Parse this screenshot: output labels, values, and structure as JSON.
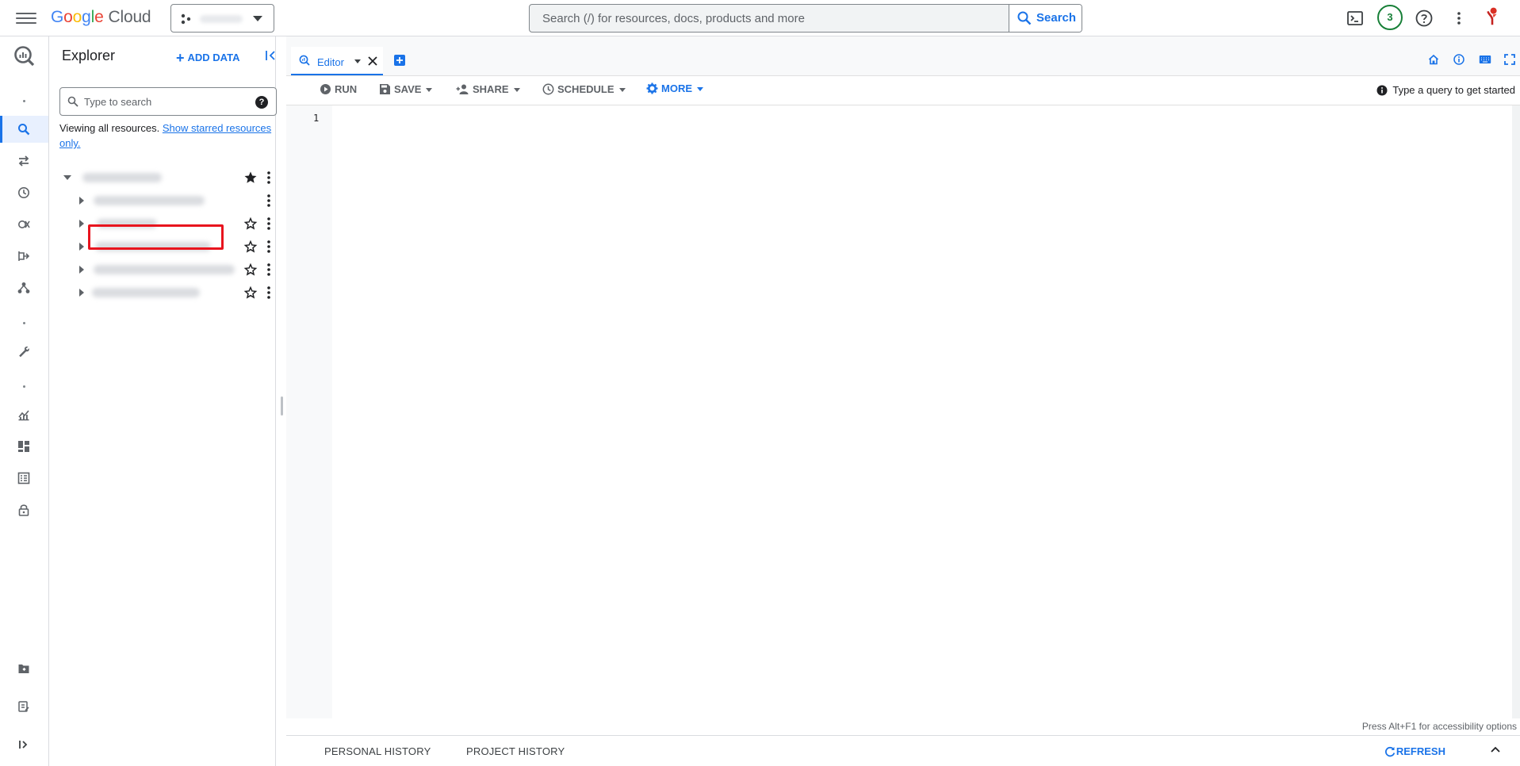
{
  "topbar": {
    "logo": {
      "letters": [
        "G",
        "o",
        "o",
        "g",
        "l",
        "e"
      ],
      "product": "Cloud"
    },
    "search": {
      "placeholder": "Search (/) for resources, docs, products and more",
      "button_label": "Search"
    },
    "notification_count": "3",
    "icons": [
      "menu-icon",
      "project-picker-icon",
      "cloud-shell-icon",
      "help-icon",
      "more-vert-icon",
      "account-avatar-icon"
    ]
  },
  "rail": {
    "icons": [
      "bigquery-logo-icon",
      "search-icon",
      "transfers-icon",
      "scheduled-queries-icon",
      "analytics-hub-icon",
      "dataflow-icon",
      "workflow-icon",
      "tools-icon",
      "monitoring-icon",
      "dashboard-icon",
      "table-icon",
      "lock-icon",
      "release-notes-icon",
      "notes-icon",
      "expand-rail-icon"
    ],
    "active": "search-icon"
  },
  "explorer": {
    "title": "Explorer",
    "add_data_label": "ADD DATA",
    "search_placeholder": "Type to search",
    "viewing_text": "Viewing all resources.",
    "viewing_link": "Show starred resources only.",
    "tree": [
      {
        "level": 0,
        "expanded": true,
        "starred": true
      },
      {
        "level": 1,
        "starred": null
      },
      {
        "level": 1,
        "starred": false
      },
      {
        "level": 1,
        "starred": false,
        "highlighted": true
      },
      {
        "level": 1,
        "starred": false
      },
      {
        "level": 1,
        "starred": false
      }
    ]
  },
  "editor": {
    "tab_label": "Editor",
    "toolbar": {
      "run": "RUN",
      "save": "SAVE",
      "share": "SHARE",
      "schedule": "SCHEDULE",
      "more": "MORE"
    },
    "hint": "Type a query to get started",
    "line_number": "1",
    "accessibility_hint": "Press Alt+F1 for accessibility options"
  },
  "history": {
    "personal": "PERSONAL HISTORY",
    "project": "PROJECT HISTORY",
    "refresh": "REFRESH"
  },
  "colors": {
    "accent": "#1a73e8",
    "highlight_box": "#e8141e",
    "badge_green": "#188038"
  }
}
